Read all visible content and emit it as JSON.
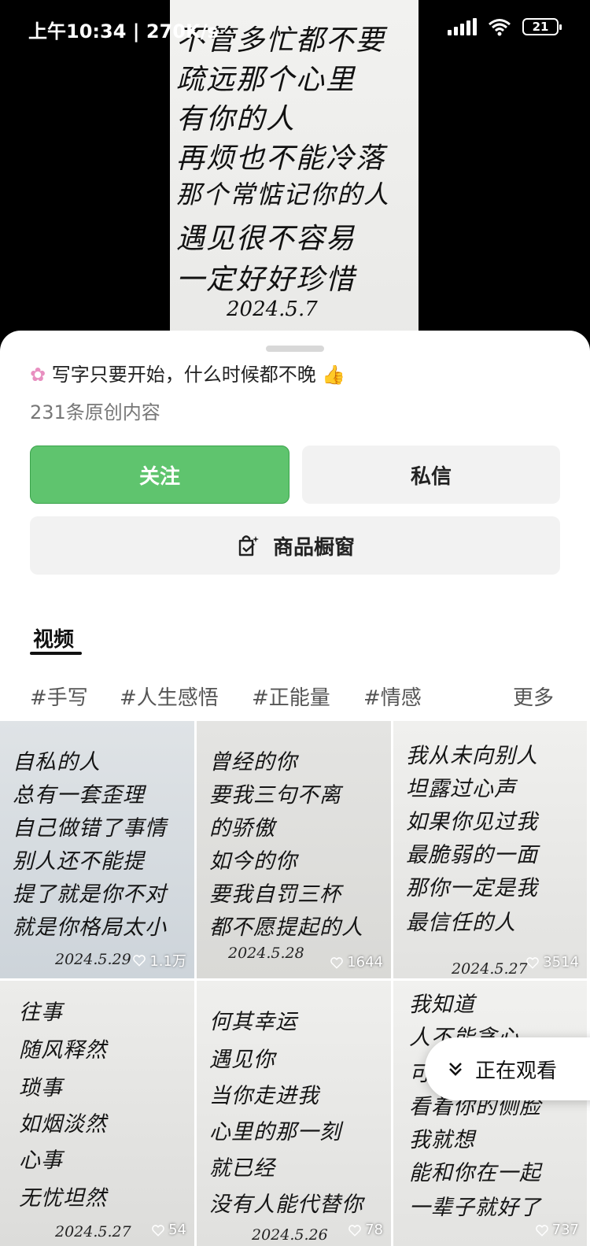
{
  "status_bar": {
    "time": "上午10:34 | 270K/s",
    "battery": "21"
  },
  "hero": {
    "lines": [
      "不管多忙都不要",
      "疏远那个心里",
      "有你的人",
      "再烦也不能冷落",
      "那个常惦记你的人",
      "遇见很不容易",
      "一定好好珍惜"
    ],
    "date": "2024.5.7"
  },
  "profile": {
    "bio": "写字只要开始，什么时候都不晚",
    "original_count": "231条原创内容"
  },
  "buttons": {
    "follow": "关注",
    "message": "私信",
    "shop": "商品橱窗"
  },
  "tabs": {
    "video": "视频"
  },
  "tags": [
    "#手写",
    "#人生感悟",
    "#正能量",
    "#情感"
  ],
  "tags_more": "更多",
  "videos": [
    {
      "lines": [
        "自私的人",
        "总有一套歪理",
        "自己做错了事情",
        "别人还不能提",
        "提了就是你不对",
        "就是你格局太小"
      ],
      "date": "2024.5.29",
      "likes": "1.1万"
    },
    {
      "lines": [
        "曾经的你",
        "要我三句不离",
        "的骄傲",
        "如今的你",
        "要我自罚三杯",
        "都不愿提起的人"
      ],
      "date": "2024.5.28",
      "likes": "1644"
    },
    {
      "lines": [
        "我从未向别人",
        "坦露过心声",
        "如果你见过我",
        "最脆弱的一面",
        "那你一定是我",
        "最信任的人"
      ],
      "date": "2024.5.27",
      "likes": "3514"
    },
    {
      "lines": [
        "往事",
        "随风释然",
        "琐事",
        "如烟淡然",
        "心事",
        "无忧坦然"
      ],
      "date": "2024.5.27",
      "likes": "54"
    },
    {
      "lines": [
        "何其幸运",
        "遇见你",
        "当你走进我",
        "心里的那一刻",
        "就已经",
        "没有人能代替你"
      ],
      "date": "2024.5.26",
      "likes": "78"
    },
    {
      "lines": [
        "我知道",
        "人不能贪心",
        "可",
        "看着你的侧脸",
        "我就想",
        "能和你在一起",
        "一辈子就好了"
      ],
      "date": "",
      "likes": "737"
    }
  ],
  "watching_label": "正在观看",
  "colors": {
    "follow_green": "#5fc46e",
    "secondary_button_bg": "#f2f2f2",
    "muted_text": "#777777"
  }
}
